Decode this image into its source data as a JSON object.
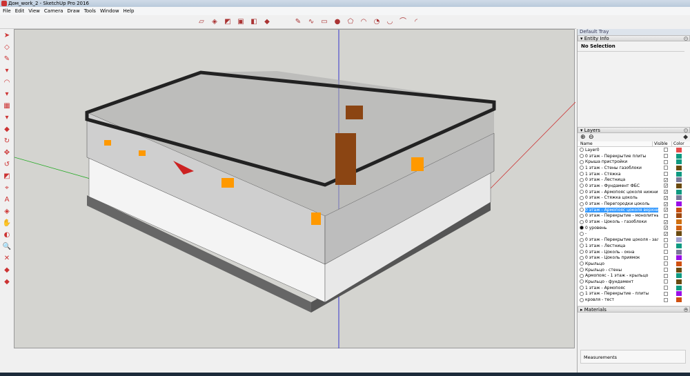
{
  "window": {
    "title": "Дом_work_2 - SketchUp Pro 2016"
  },
  "menu": [
    "File",
    "Edit",
    "View",
    "Camera",
    "Draw",
    "Tools",
    "Window",
    "Help"
  ],
  "tray": {
    "title": "Default Tray",
    "entity_info": {
      "label": "Entity Info",
      "selection": "No Selection"
    },
    "layers": {
      "label": "Layers",
      "col_name": "Name",
      "col_visible": "Visible",
      "col_color": "Color",
      "items": [
        {
          "name": "Layer0",
          "visible": false,
          "color": "#e84c4c",
          "active": false
        },
        {
          "name": "0 этаж - Перекрытие плиты",
          "visible": false,
          "color": "#0f9a82"
        },
        {
          "name": "Крыша пристройки",
          "visible": false,
          "color": "#0f9a82"
        },
        {
          "name": "1 этаж - Стены газоблоки",
          "visible": false,
          "color": "#6b4a10"
        },
        {
          "name": "1 этаж - Стяжка",
          "visible": false,
          "color": "#0f9a82"
        },
        {
          "name": "0 этаж - Лестница",
          "visible": true,
          "color": "#7a7898"
        },
        {
          "name": "0 этаж - Фундамент ФБС",
          "visible": true,
          "color": "#6b4a10"
        },
        {
          "name": "0 этаж - Армопояс цоколя нижний",
          "visible": true,
          "color": "#0f9a82"
        },
        {
          "name": "0 этаж - Стяжка цоколь",
          "visible": true,
          "color": "#7a7898"
        },
        {
          "name": "0 этаж - Перегородки цоколь",
          "visible": true,
          "color": "#9a10e8"
        },
        {
          "name": "0 этаж - Армопояс цоколя верхний",
          "visible": true,
          "color": "#c85010",
          "selected": true
        },
        {
          "name": "0 этаж - Перекрытие - монолитные у",
          "visible": false,
          "color": "#a04a10"
        },
        {
          "name": "0 этаж - Цоколь - газоблоки",
          "visible": true,
          "color": "#d07010"
        },
        {
          "name": "0 уровень",
          "visible": true,
          "color": "#d06010",
          "active": true
        },
        {
          "name": "-",
          "visible": true,
          "color": "#6b4a10"
        },
        {
          "name": "0 этаж - Перекрытие цоколя - залив",
          "visible": false,
          "color": "#a0a0d0"
        },
        {
          "name": "1 этаж - Лестница",
          "visible": false,
          "color": "#0f9a82"
        },
        {
          "name": "0 этаж - Цоколь - окна",
          "visible": false,
          "color": "#7a7898"
        },
        {
          "name": "0 этаж - Цоколь приямок",
          "visible": false,
          "color": "#9a10e8"
        },
        {
          "name": "Крыльцо",
          "visible": false,
          "color": "#d05010"
        },
        {
          "name": "Крыльцо - стены",
          "visible": false,
          "color": "#6b4a10"
        },
        {
          "name": "Армопояс - 1 этаж - крыльцо",
          "visible": false,
          "color": "#0f9a82"
        },
        {
          "name": "Крыльцо - фундамент",
          "visible": false,
          "color": "#6b4a10"
        },
        {
          "name": "1 этаж - Армопояс",
          "visible": false,
          "color": "#0f9a82"
        },
        {
          "name": "1 этаж - Перекрытие - плиты",
          "visible": false,
          "color": "#9a10e8"
        },
        {
          "name": "кровля - тест",
          "visible": false,
          "color": "#d05010"
        }
      ]
    },
    "materials": {
      "label": "Materials"
    },
    "measurements": {
      "label": "Measurements"
    }
  }
}
